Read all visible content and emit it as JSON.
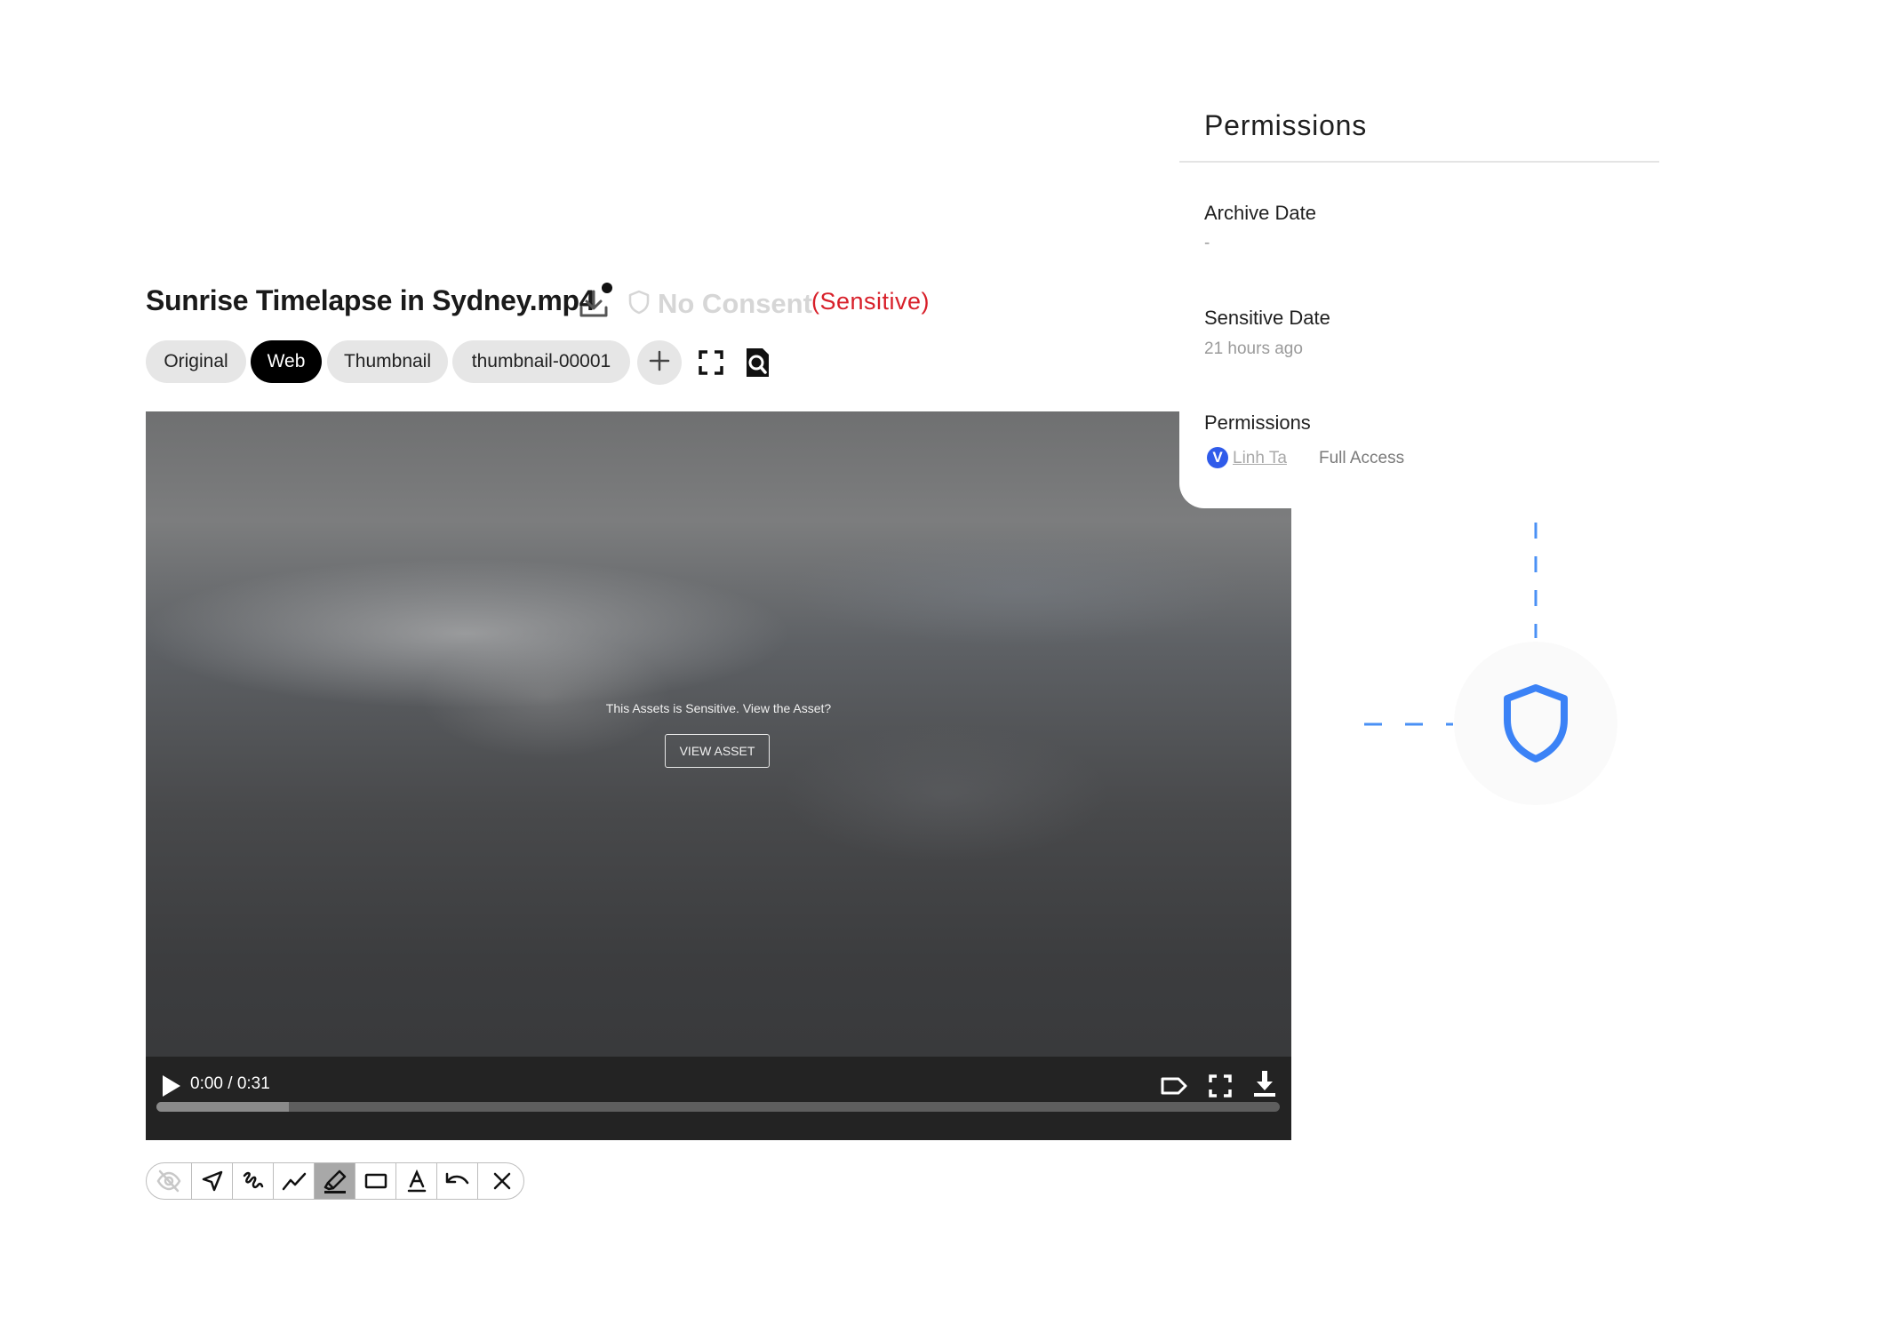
{
  "asset": {
    "title": "Sunrise Timelapse in Sydney.mp4",
    "consent_label": "No Consent",
    "sensitive_label": "(Sensitive)"
  },
  "icons": {
    "download": "download-icon",
    "consent": "shield-outline-icon",
    "add": "plus-icon",
    "expand": "expand-icon",
    "zoom": "search-document-icon",
    "play": "play-icon",
    "tag": "tag-icon",
    "fullscreen": "fullscreen-icon",
    "video_download": "download-arrow-icon",
    "shield": "shield-icon"
  },
  "renditions": [
    {
      "label": "Original",
      "active": false
    },
    {
      "label": "Web",
      "active": true
    },
    {
      "label": "Thumbnail",
      "active": false
    },
    {
      "label": "thumbnail-00001",
      "active": false
    }
  ],
  "video": {
    "sensitive_message": "This Assets is Sensitive. View the Asset?",
    "view_button": "VIEW ASSET",
    "time": "0:00 / 0:31",
    "buffered_fraction": 0.118
  },
  "annotation_tools": [
    {
      "name": "hide-annotations",
      "icon": "eye-off-icon"
    },
    {
      "name": "pointer",
      "icon": "navigation-arrow-icon"
    },
    {
      "name": "freehand",
      "icon": "freehand-icon"
    },
    {
      "name": "line",
      "icon": "polyline-icon"
    },
    {
      "name": "highlighter",
      "icon": "highlighter-icon",
      "active": true
    },
    {
      "name": "rectangle",
      "icon": "rectangle-icon"
    },
    {
      "name": "text",
      "icon": "text-icon"
    },
    {
      "name": "undo",
      "icon": "undo-icon"
    },
    {
      "name": "close",
      "icon": "close-icon"
    }
  ],
  "permissions_panel": {
    "title": "Permissions",
    "archive_label": "Archive Date",
    "archive_value": "-",
    "sensitive_label": "Sensitive Date",
    "sensitive_value": "21 hours ago",
    "permissions_label": "Permissions",
    "user_initial": "V",
    "user_name": "Linh Ta",
    "user_access": "Full Access"
  },
  "colors": {
    "accent_blue": "#3b82f6",
    "sensitive_red": "#d8202a",
    "avatar_blue": "#2f5bea"
  }
}
